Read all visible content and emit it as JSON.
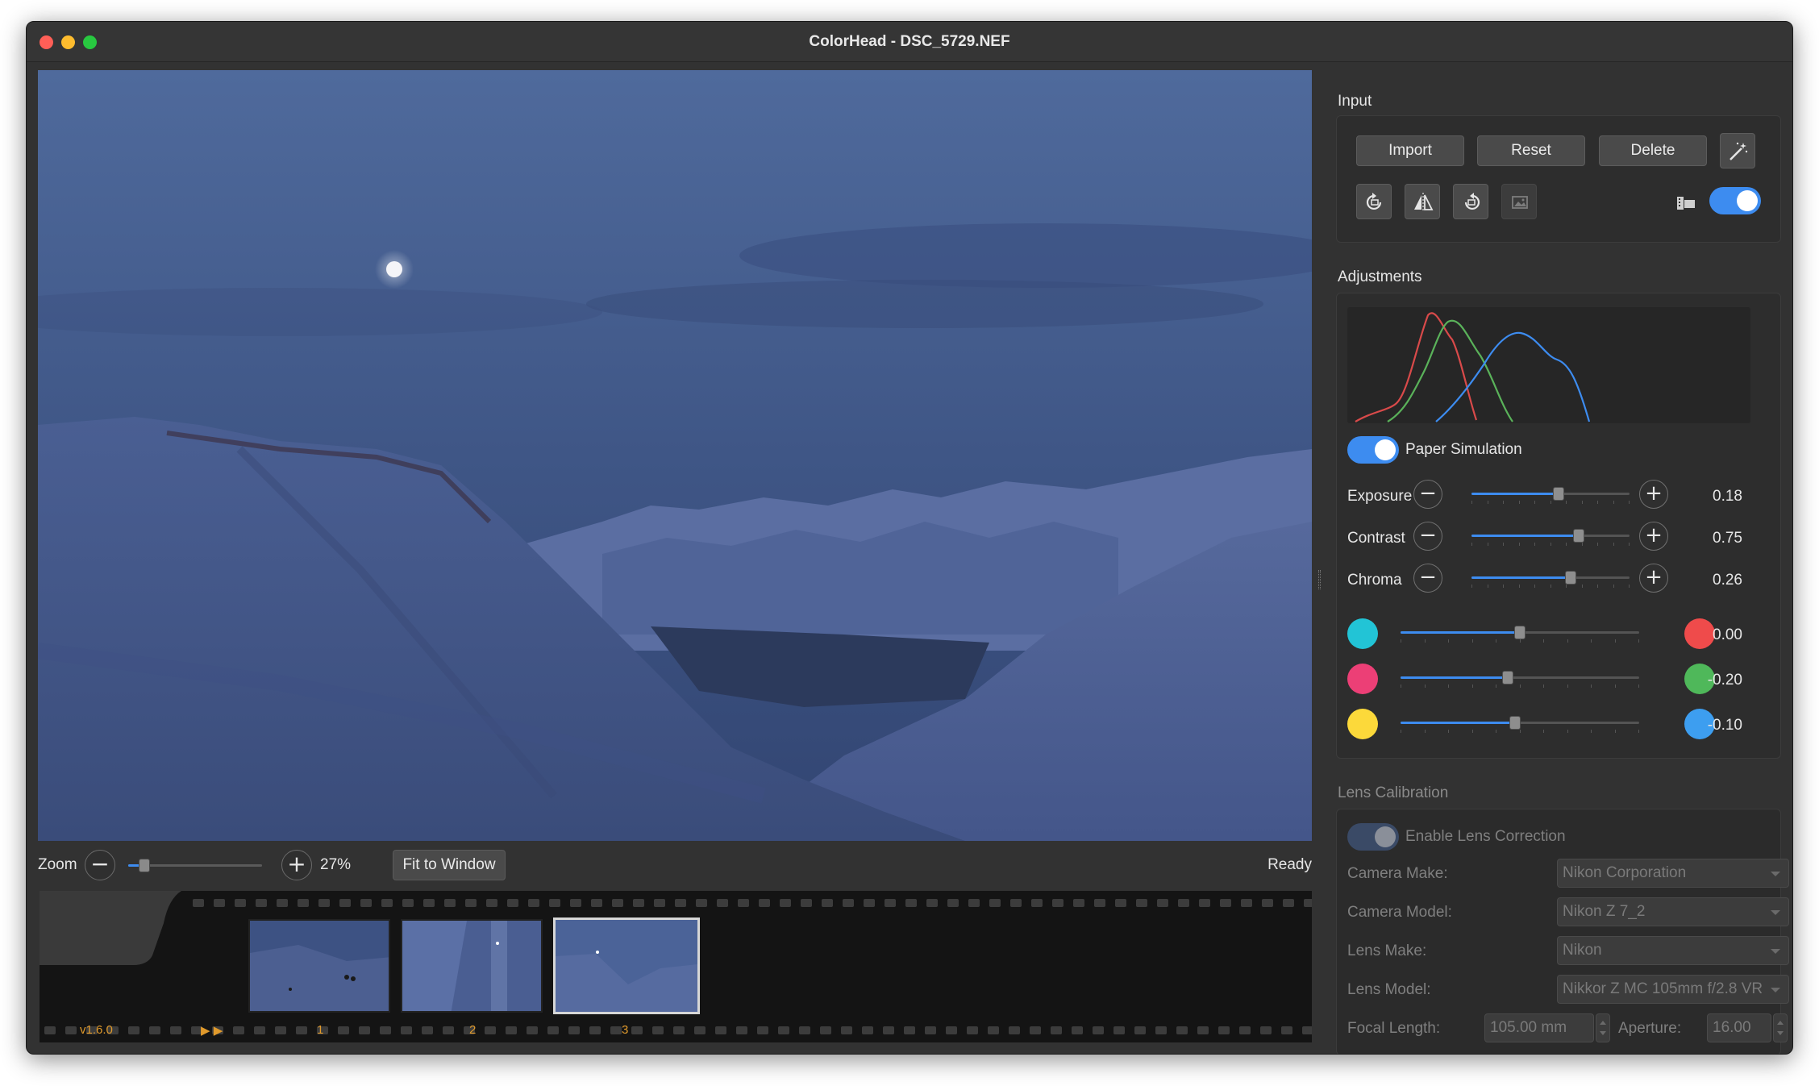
{
  "window": {
    "title": "ColorHead - DSC_5729.NEF"
  },
  "zoom": {
    "label": "Zoom",
    "value": "27%",
    "level_fraction": 0.12,
    "fit_label": "Fit to Window",
    "status": "Ready"
  },
  "filmstrip": {
    "version": "v1.6.0",
    "frames": [
      "1",
      "2",
      "3"
    ],
    "selected": "3"
  },
  "input": {
    "title": "Input",
    "import_label": "Import",
    "reset_label": "Reset",
    "delete_label": "Delete",
    "icons": [
      "rotate-left-icon",
      "flip-horizontal-icon",
      "rotate-right-icon",
      "crop-icon",
      "magic-wand-icon",
      "film-icon"
    ],
    "toggle_on": true
  },
  "adjustments": {
    "title": "Adjustments",
    "paper_simulation_label": "Paper Simulation",
    "paper_simulation_on": true,
    "sliders": [
      {
        "label": "Exposure",
        "value": "0.18",
        "fraction": 0.55
      },
      {
        "label": "Contrast",
        "value": "0.75",
        "fraction": 0.68
      },
      {
        "label": "Chroma",
        "value": "0.26",
        "fraction": 0.63
      }
    ],
    "color_balance": [
      {
        "left_color": "#22c4d6",
        "right_color": "#ef4b4b",
        "value": "0.00",
        "fraction": 0.5
      },
      {
        "left_color": "#ec3f76",
        "right_color": "#4fb85a",
        "value": "-0.20",
        "fraction": 0.45
      },
      {
        "left_color": "#fcd93a",
        "right_color": "#3d9ef0",
        "value": "-0.10",
        "fraction": 0.48
      }
    ]
  },
  "lens": {
    "title": "Lens Calibration",
    "enable_label": "Enable Lens Correction",
    "camera_make_label": "Camera Make:",
    "camera_make": "Nikon Corporation",
    "camera_model_label": "Camera Model:",
    "camera_model": "Nikon Z 7_2",
    "lens_make_label": "Lens Make:",
    "lens_make": "Nikon",
    "lens_model_label": "Lens Model:",
    "lens_model": "Nikkor Z MC 105mm f/2.8 VR",
    "focal_length_label": "Focal Length:",
    "focal_length": "105.00 mm",
    "aperture_label": "Aperture:",
    "aperture": "16.00"
  },
  "colors": {
    "accent": "#3d8cf0",
    "orange": "#e09a2c"
  }
}
